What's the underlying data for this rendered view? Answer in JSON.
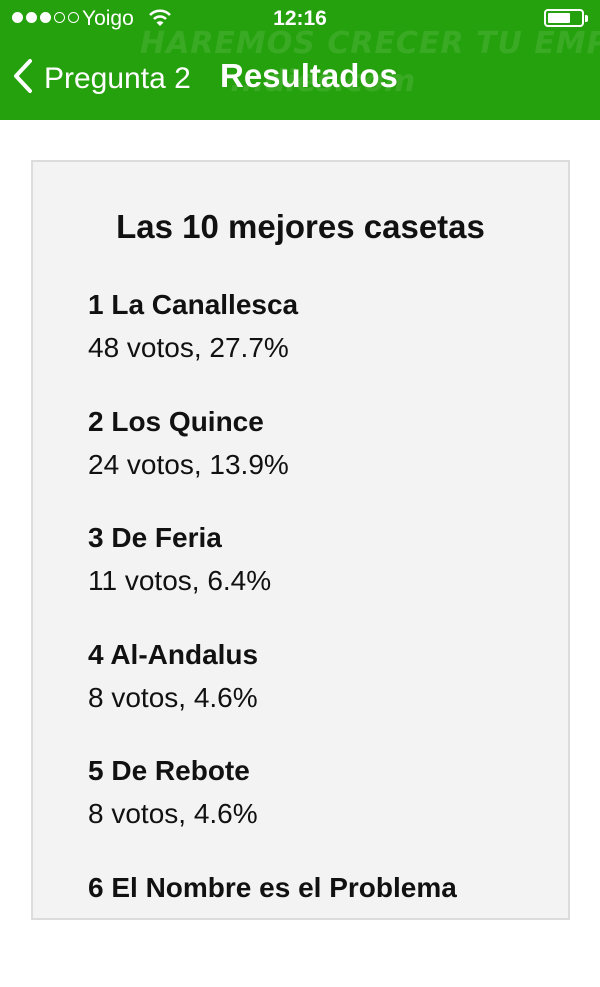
{
  "status_bar": {
    "carrier": "Yoigo",
    "time": "12:16",
    "signal_bars_filled": 3,
    "signal_bars_total": 5
  },
  "nav": {
    "back_label": "Pregunta 2",
    "title": "Resultados"
  },
  "watermark": {
    "line1": "HAREMOS CRECER TU EMPRESA",
    "line2": "...dies.com"
  },
  "card": {
    "title": "Las 10 mejores casetas",
    "items": [
      {
        "name": "1 La Canallesca",
        "votes": "48 votos, 27.7%"
      },
      {
        "name": "2 Los Quince",
        "votes": "24 votos, 13.9%"
      },
      {
        "name": "3 De Feria",
        "votes": "11 votos, 6.4%"
      },
      {
        "name": "4 Al-Andalus",
        "votes": "8 votos, 4.6%"
      },
      {
        "name": "5 De Rebote",
        "votes": "8 votos, 4.6%"
      },
      {
        "name": "6 El Nombre es el Problema",
        "votes": ""
      }
    ]
  },
  "colors": {
    "header_green": "#24a10d",
    "card_background": "#f3f3f3"
  }
}
